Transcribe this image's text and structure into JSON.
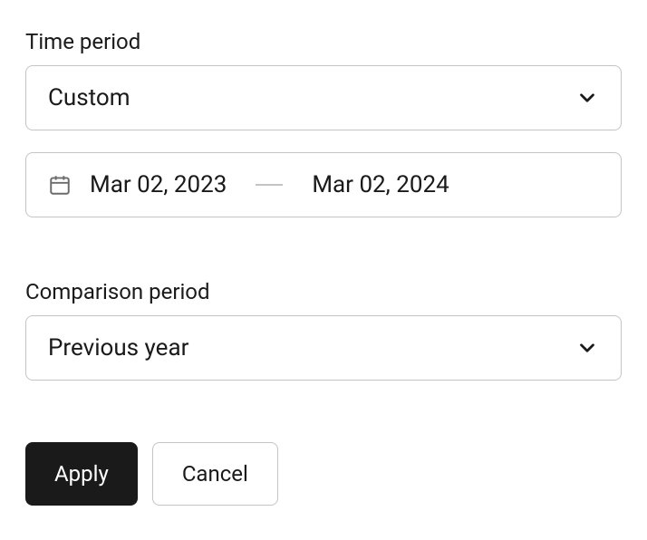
{
  "time_period": {
    "label": "Time period",
    "selected": "Custom",
    "range": {
      "start": "Mar 02, 2023",
      "end": "Mar 02, 2024"
    }
  },
  "comparison_period": {
    "label": "Comparison period",
    "selected": "Previous year"
  },
  "actions": {
    "apply": "Apply",
    "cancel": "Cancel"
  }
}
